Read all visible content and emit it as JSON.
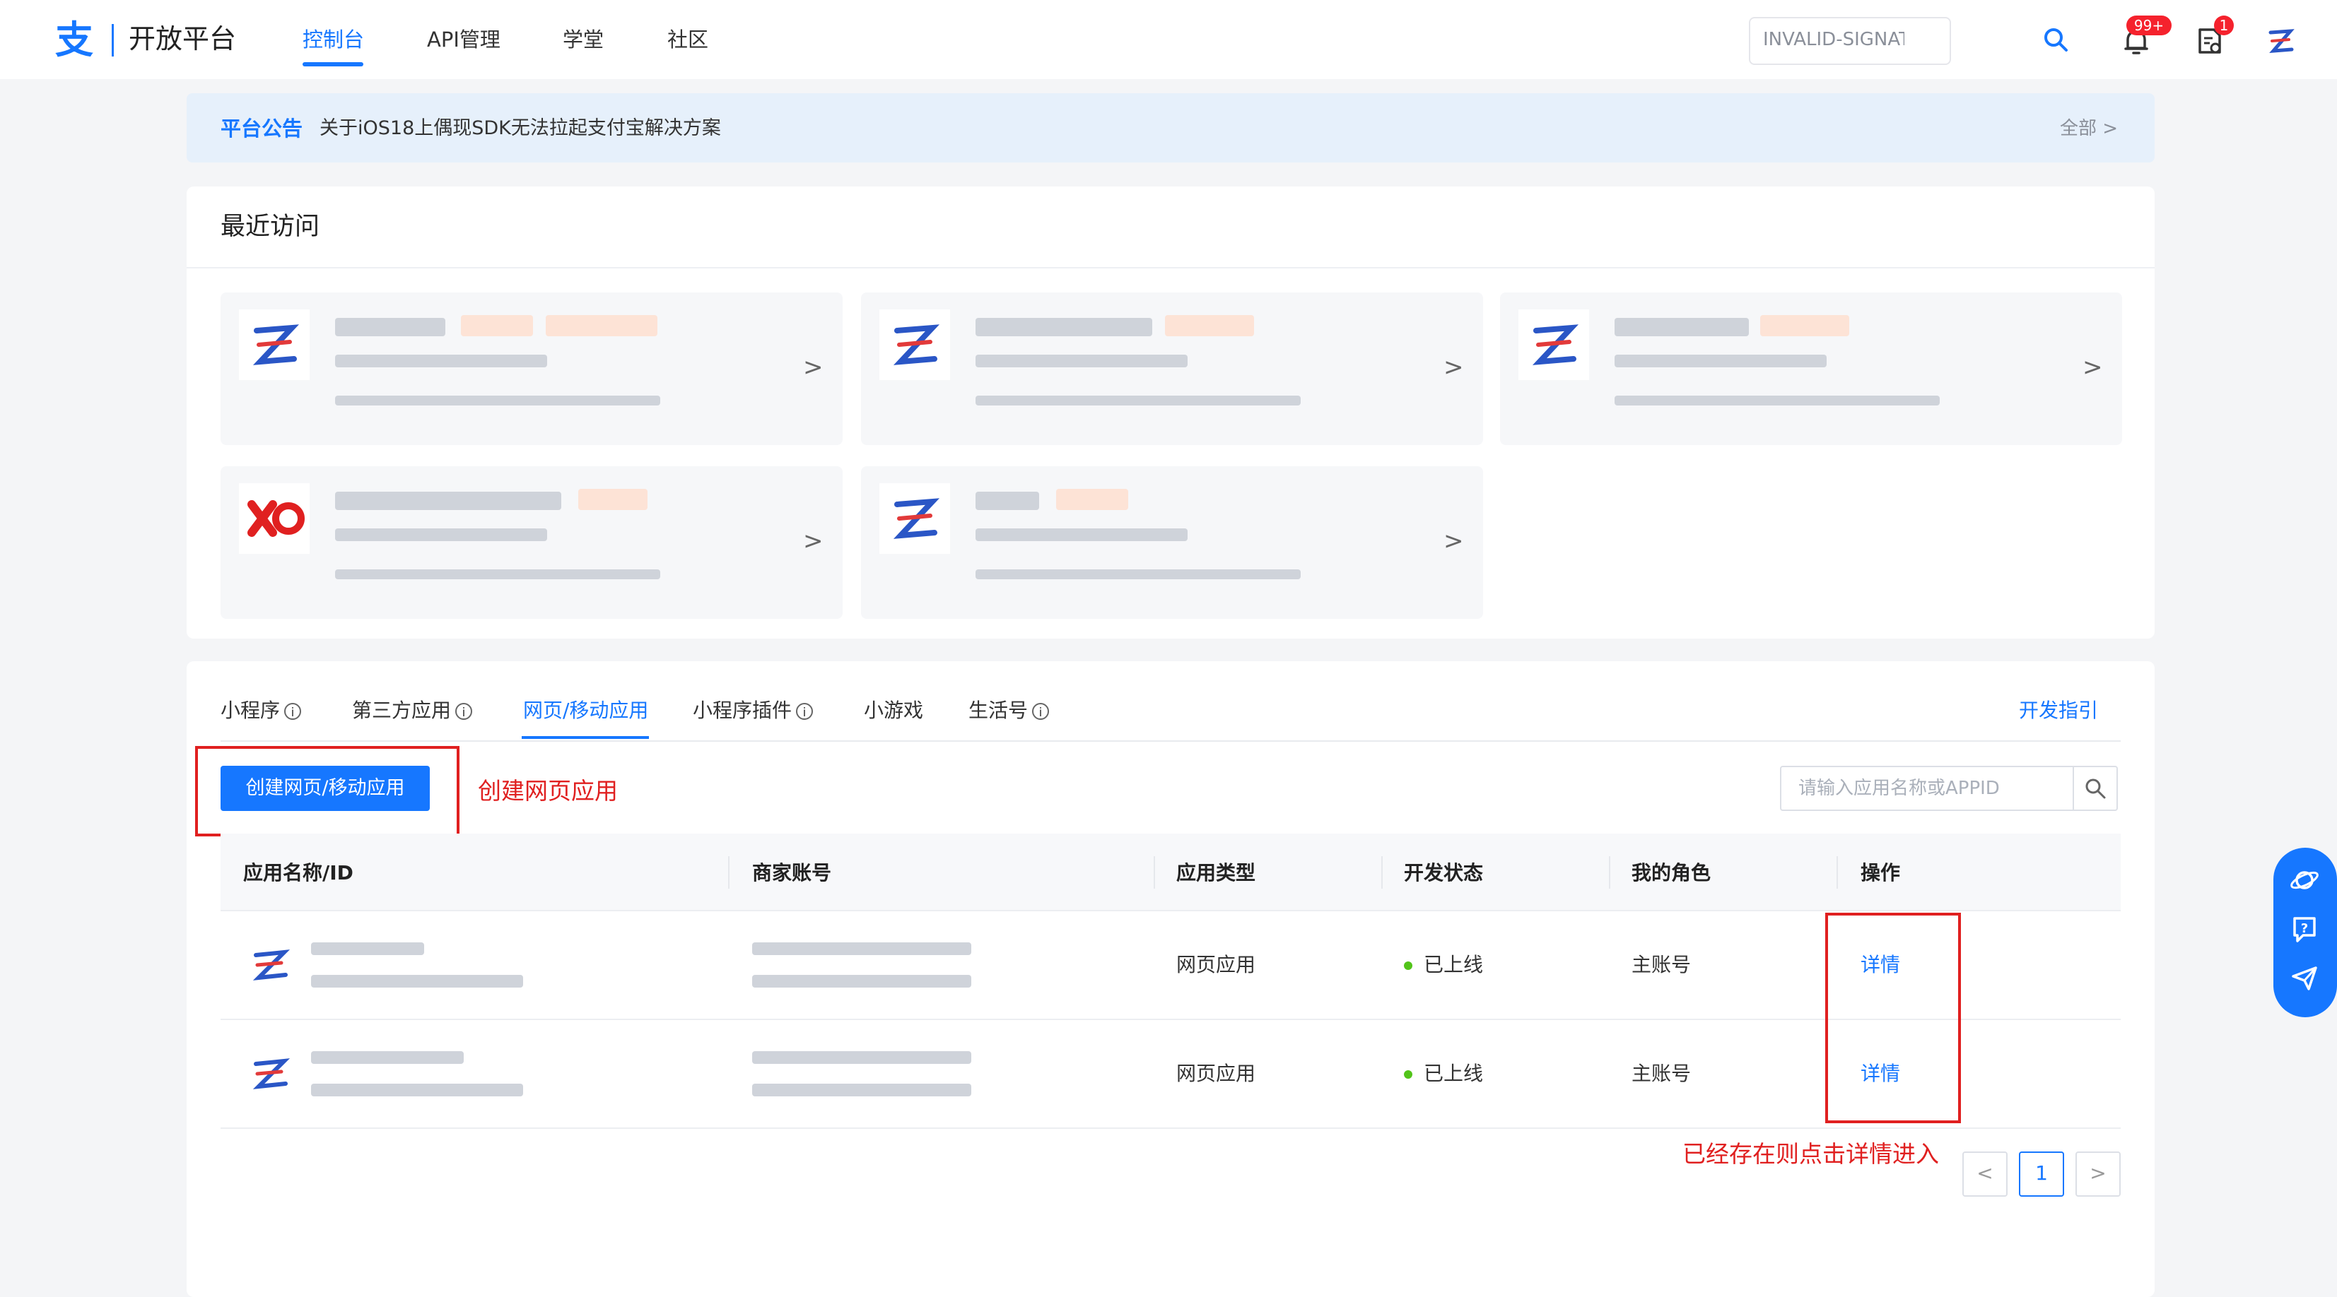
{
  "header": {
    "logo_mark": "支",
    "title": "开放平台",
    "nav": [
      "控制台",
      "API管理",
      "学堂",
      "社区"
    ],
    "search_value": "INVALID-SIGNATURE 验签...",
    "notif_badge": "99+",
    "doc_badge": "1"
  },
  "announcement": {
    "title": "平台公告",
    "text": "关于iOS18上偶现SDK无法拉起支付宝解决方案",
    "all": "全部 >"
  },
  "recent": {
    "title": "最近访问",
    "chevron": ">"
  },
  "tabs": [
    "小程序",
    "第三方应用",
    "网页/移动应用",
    "小程序插件",
    "小游戏",
    "生活号"
  ],
  "info_glyph": "i",
  "dev_guide": "开发指引",
  "create_button": "创建网页/移动应用",
  "create_annotation": "创建网页应用",
  "list_search_placeholder": "请输入应用名称或APPID",
  "table": {
    "headers": [
      "应用名称/ID",
      "商家账号",
      "应用类型",
      "开发状态",
      "我的角色",
      "操作"
    ],
    "rows": [
      {
        "type": "网页应用",
        "status": "已上线",
        "role": "主账号",
        "action": "详情"
      },
      {
        "type": "网页应用",
        "status": "已上线",
        "role": "主账号",
        "action": "详情"
      }
    ]
  },
  "detail_annotation": "已经存在则点击详情进入",
  "pagination": {
    "prev": "<",
    "current": "1",
    "next": ">"
  },
  "colors": {
    "accent": "#1677ff",
    "annotation": "#e02020",
    "online": "#52c41a"
  }
}
